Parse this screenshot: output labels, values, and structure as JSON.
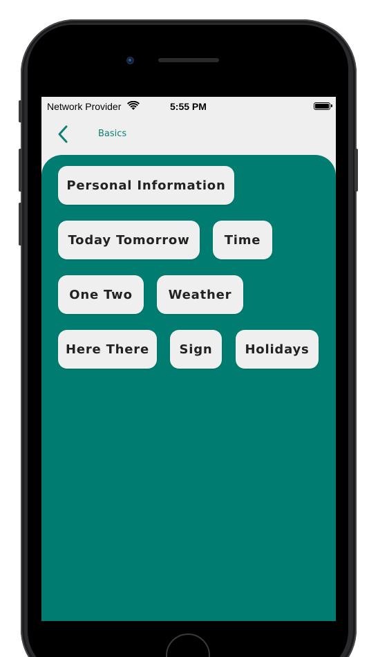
{
  "status_bar": {
    "carrier": "Network Provider",
    "time": "5:55 PM"
  },
  "nav": {
    "title": "Basics"
  },
  "topics": [
    {
      "label": "Personal Information"
    },
    {
      "label": "Today Tomorrow"
    },
    {
      "label": "Time"
    },
    {
      "label": "One Two"
    },
    {
      "label": "Weather"
    },
    {
      "label": "Here There"
    },
    {
      "label": "Sign"
    },
    {
      "label": "Holidays"
    }
  ],
  "colors": {
    "accent": "#007d70",
    "nav_text": "#0f7f72",
    "chip_background": "#efefef",
    "screen_background": "#efefef"
  }
}
